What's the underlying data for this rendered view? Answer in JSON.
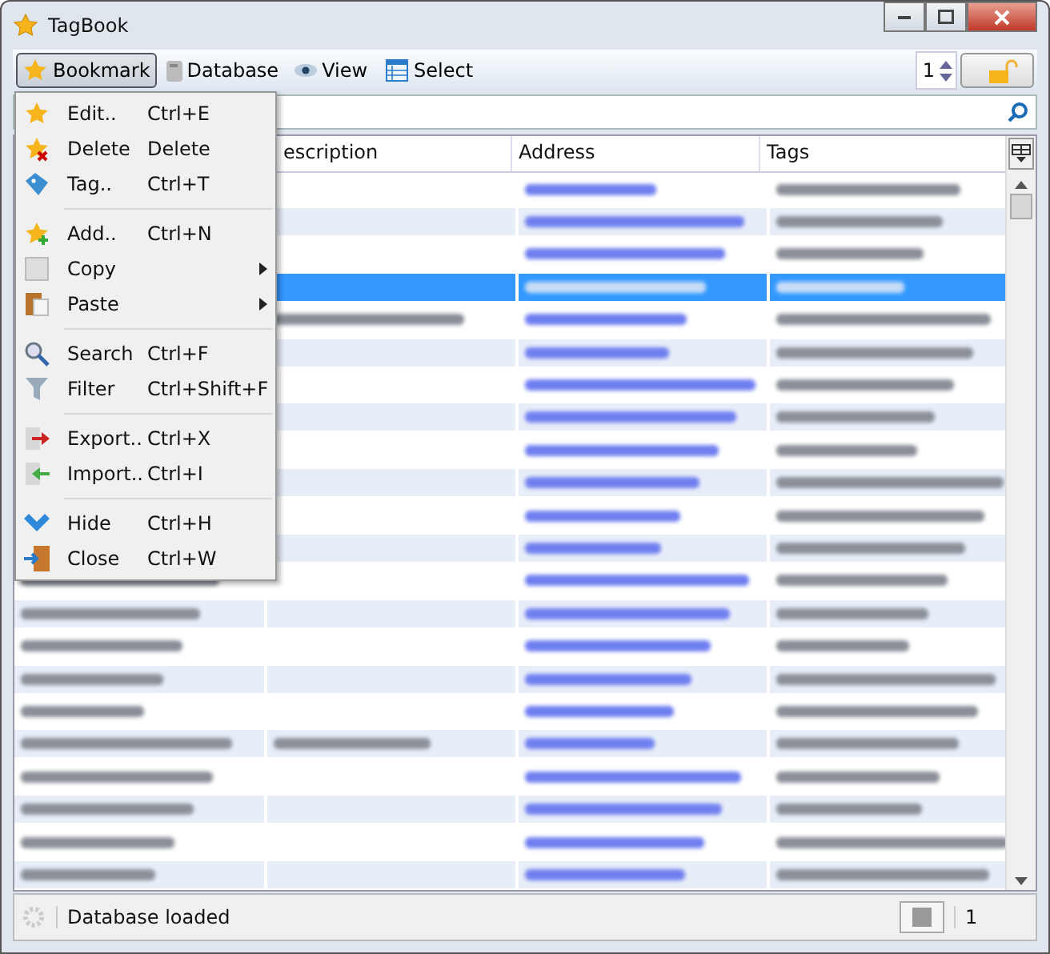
{
  "window": {
    "title": "TagBook"
  },
  "toolbar": {
    "menus": [
      {
        "label": "Bookmark",
        "selected": true
      },
      {
        "label": "Database",
        "selected": false
      },
      {
        "label": "View",
        "selected": false
      },
      {
        "label": "Select",
        "selected": false
      }
    ],
    "page": "1"
  },
  "menu": [
    {
      "kind": "item",
      "label": "Edit..",
      "shortcut": "Ctrl+E"
    },
    {
      "kind": "item",
      "label": "Delete",
      "shortcut": "Delete"
    },
    {
      "kind": "item",
      "label": "Tag..",
      "shortcut": "Ctrl+T"
    },
    {
      "kind": "separator"
    },
    {
      "kind": "item",
      "label": "Add..",
      "shortcut": "Ctrl+N"
    },
    {
      "kind": "submenu",
      "label": "Copy"
    },
    {
      "kind": "submenu",
      "label": "Paste"
    },
    {
      "kind": "separator"
    },
    {
      "kind": "item",
      "label": "Search",
      "shortcut": "Ctrl+F"
    },
    {
      "kind": "item",
      "label": "Filter",
      "shortcut": "Ctrl+Shift+F"
    },
    {
      "kind": "separator"
    },
    {
      "kind": "item",
      "label": "Export..",
      "shortcut": "Ctrl+X"
    },
    {
      "kind": "item",
      "label": "Import..",
      "shortcut": "Ctrl+I"
    },
    {
      "kind": "separator"
    },
    {
      "kind": "item",
      "label": "Hide",
      "shortcut": "Ctrl+H"
    },
    {
      "kind": "item",
      "label": "Close",
      "shortcut": "Ctrl+W"
    }
  ],
  "table": {
    "columns": [
      "escription",
      "Address",
      "Tags"
    ],
    "rows": [
      {
        "selected": false
      },
      {
        "selected": false
      },
      {
        "selected": false
      },
      {
        "selected": true
      },
      {
        "selected": false
      },
      {
        "selected": false
      },
      {
        "selected": false
      },
      {
        "selected": false
      },
      {
        "selected": false
      },
      {
        "selected": false
      },
      {
        "selected": false
      },
      {
        "selected": false
      },
      {
        "selected": false
      },
      {
        "selected": false
      },
      {
        "selected": false
      },
      {
        "selected": false
      },
      {
        "selected": false
      },
      {
        "selected": false
      },
      {
        "selected": false
      },
      {
        "selected": false
      },
      {
        "selected": false
      },
      {
        "selected": false
      }
    ]
  },
  "status_bar": {
    "message": "Database loaded",
    "count": "1"
  }
}
